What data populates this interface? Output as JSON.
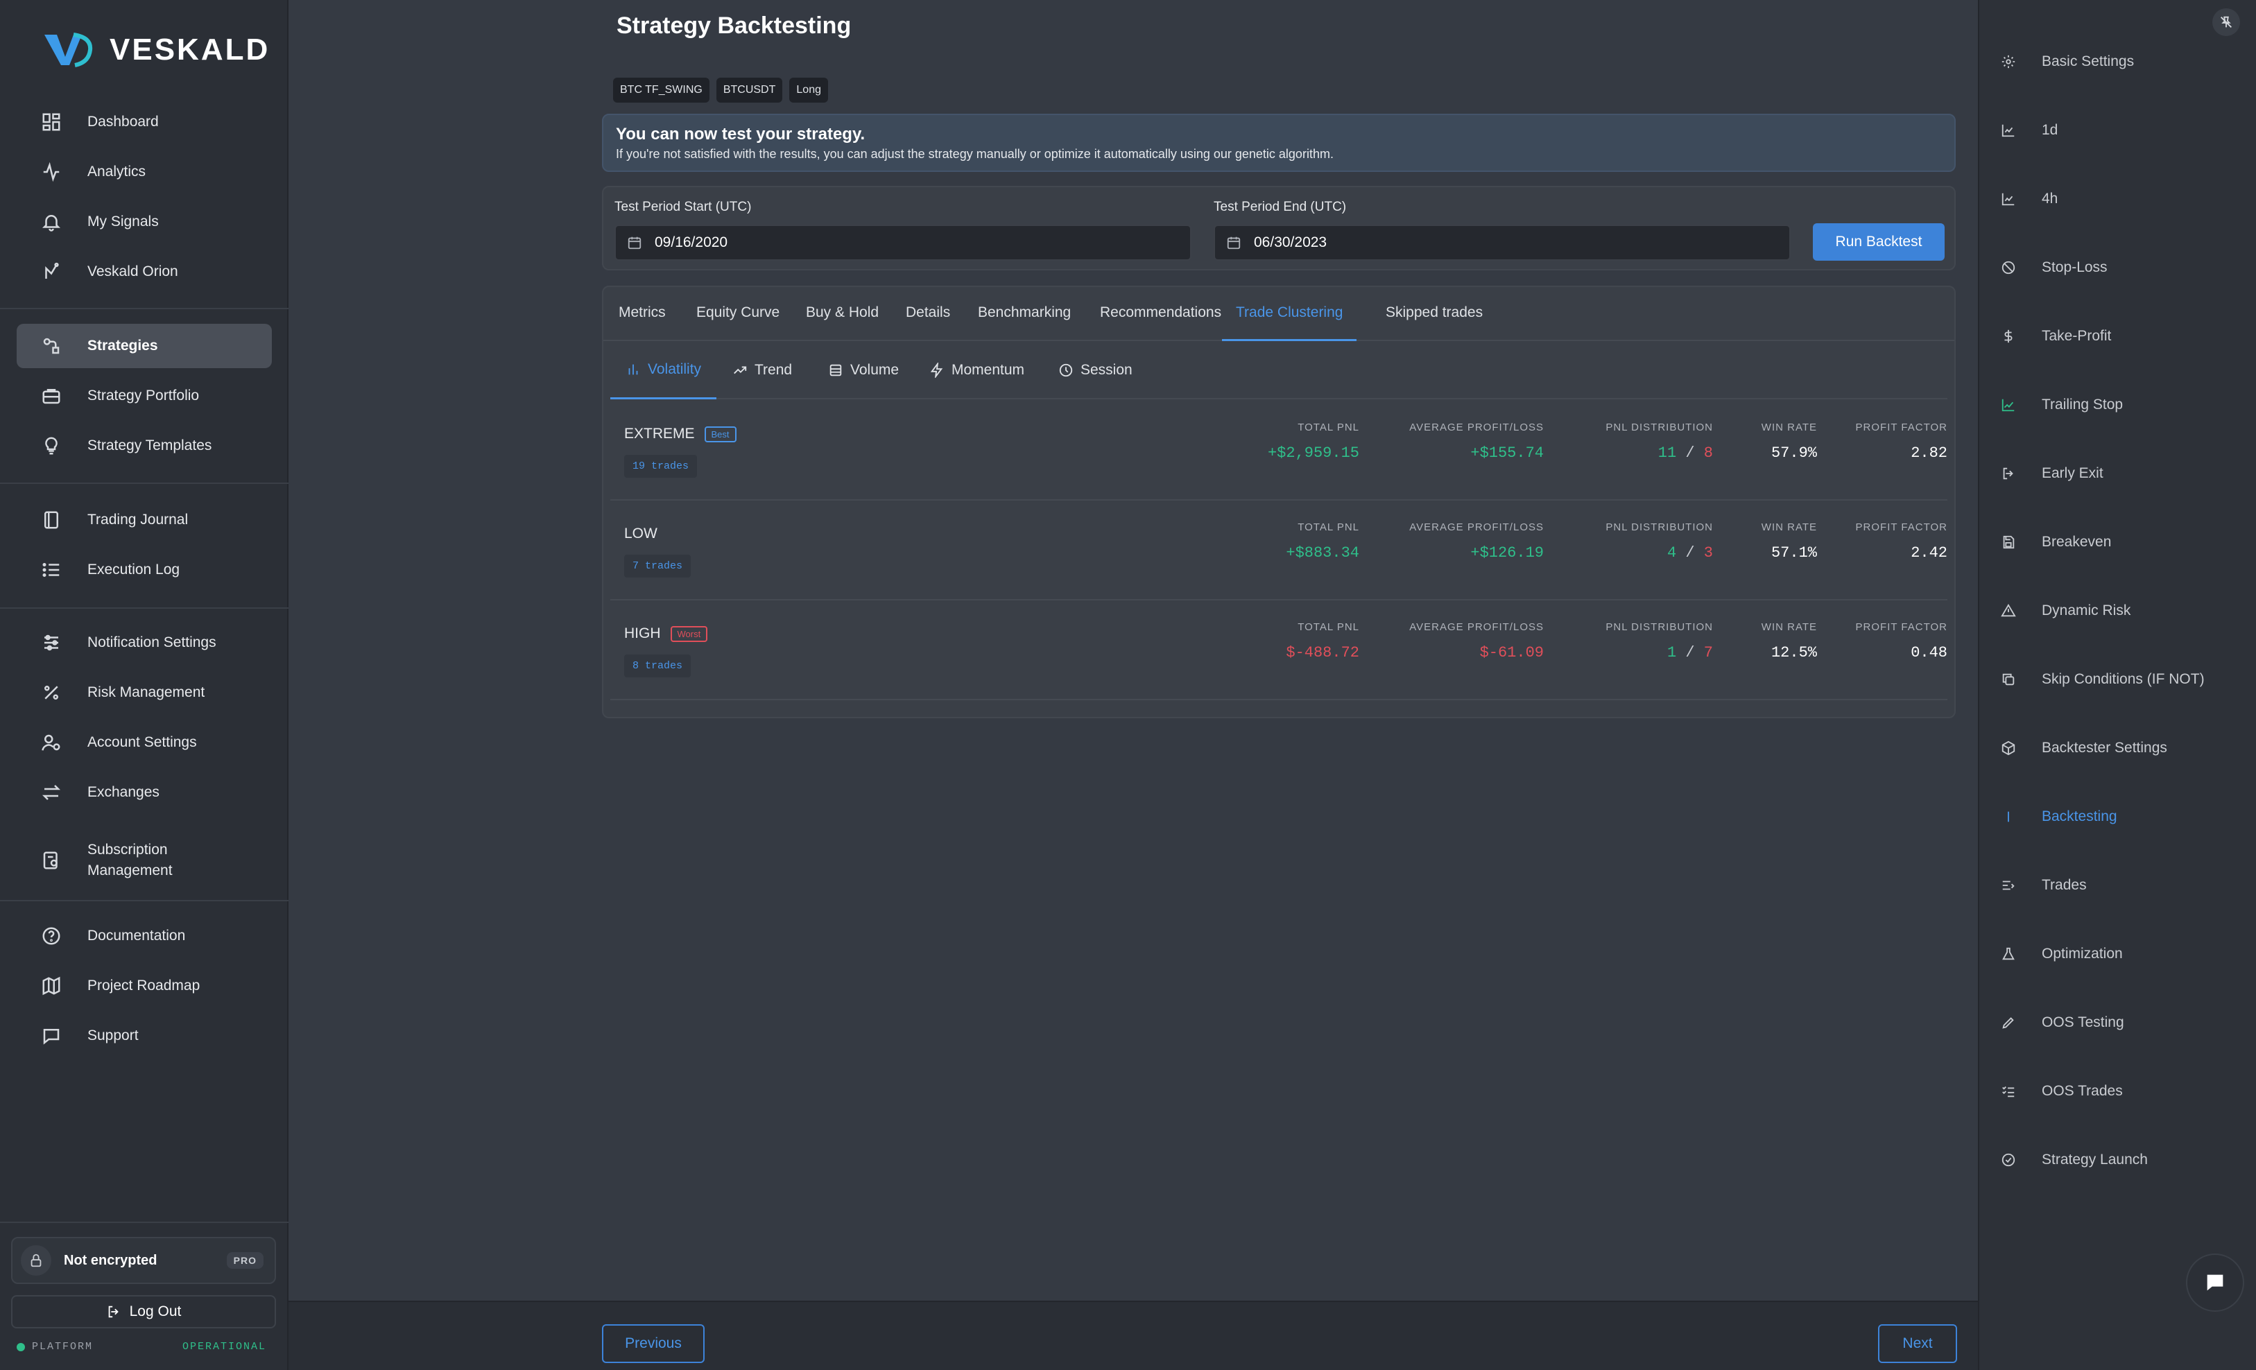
{
  "app": {
    "brand": "VESKALD"
  },
  "sidebar": {
    "groups": [
      [
        {
          "label": "Dashboard",
          "icon": "dashboard-icon"
        },
        {
          "label": "Analytics",
          "icon": "analytics-icon"
        },
        {
          "label": "My Signals",
          "icon": "bell-icon"
        },
        {
          "label": "Veskald Orion",
          "icon": "orion-icon"
        }
      ],
      [
        {
          "label": "Strategies",
          "icon": "strategies-icon",
          "active": true
        },
        {
          "label": "Strategy Portfolio",
          "icon": "briefcase-icon"
        },
        {
          "label": "Strategy Templates",
          "icon": "lightbulb-icon"
        }
      ],
      [
        {
          "label": "Trading Journal",
          "icon": "journal-icon"
        },
        {
          "label": "Execution Log",
          "icon": "list-icon"
        }
      ],
      [
        {
          "label": "Notification Settings",
          "icon": "sliders-icon"
        },
        {
          "label": "Risk Management",
          "icon": "percent-icon"
        },
        {
          "label": "Account Settings",
          "icon": "user-gear-icon"
        },
        {
          "label": "Exchanges",
          "icon": "exchange-icon"
        },
        {
          "label": "Subscription Management",
          "icon": "subscription-icon"
        }
      ],
      [
        {
          "label": "Documentation",
          "icon": "help-icon"
        },
        {
          "label": "Project Roadmap",
          "icon": "map-icon"
        },
        {
          "label": "Support",
          "icon": "chat-icon"
        }
      ]
    ],
    "encryption": {
      "label": "Not encrypted",
      "badge": "PRO"
    },
    "logout_label": "Log Out",
    "status": {
      "left": "PLATFORM",
      "right": "OPERATIONAL"
    }
  },
  "main": {
    "title": "Strategy Backtesting",
    "chips": [
      "BTC TF_SWING",
      "BTCUSDT",
      "Long"
    ],
    "info": {
      "title": "You can now test your strategy.",
      "subtitle": "If you're not satisfied with the results, you can adjust the strategy manually or optimize it automatically using our genetic algorithm."
    },
    "period": {
      "start_label": "Test Period Start (UTC)",
      "start_value": "09/16/2020",
      "end_label": "Test Period End (UTC)",
      "end_value": "06/30/2023",
      "run_label": "Run Backtest"
    },
    "tabs": [
      "Metrics",
      "Equity Curve",
      "Buy & Hold",
      "Details",
      "Benchmarking",
      "Recommendations",
      "Trade Clustering",
      "Skipped trades"
    ],
    "active_tab": "Trade Clustering",
    "subtabs": [
      "Volatility",
      "Trend",
      "Volume",
      "Momentum",
      "Session"
    ],
    "active_subtab": "Volatility",
    "metric_labels": [
      "TOTAL PNL",
      "AVERAGE PROFIT/LOSS",
      "PNL DISTRIBUTION",
      "WIN RATE",
      "PROFIT FACTOR"
    ],
    "clusters": [
      {
        "name": "EXTREME",
        "tag": "Best",
        "trades": "19 trades",
        "total_pnl": "+$2,959.15",
        "avg": "+$155.74",
        "wins": "11",
        "losses": "8",
        "win_rate": "57.9%",
        "profit_factor": "2.82"
      },
      {
        "name": "LOW",
        "tag": "",
        "trades": "7 trades",
        "total_pnl": "+$883.34",
        "avg": "+$126.19",
        "wins": "4",
        "losses": "3",
        "win_rate": "57.1%",
        "profit_factor": "2.42"
      },
      {
        "name": "HIGH",
        "tag": "Worst",
        "trades": "8 trades",
        "total_pnl": "$-488.72",
        "avg": "$-61.09",
        "wins": "1",
        "losses": "7",
        "win_rate": "12.5%",
        "profit_factor": "0.48"
      }
    ]
  },
  "pagination": {
    "previous": "Previous",
    "next": "Next"
  },
  "steps": [
    {
      "label": "Basic Settings",
      "icon": "gear-icon"
    },
    {
      "label": "1d",
      "icon": "chart-icon"
    },
    {
      "label": "4h",
      "icon": "chart-icon"
    },
    {
      "label": "Stop-Loss",
      "icon": "ban-icon"
    },
    {
      "label": "Take-Profit",
      "icon": "dollar-icon"
    },
    {
      "label": "Trailing Stop",
      "icon": "trend-icon",
      "state": "green"
    },
    {
      "label": "Early Exit",
      "icon": "exit-icon"
    },
    {
      "label": "Breakeven",
      "icon": "save-icon"
    },
    {
      "label": "Dynamic Risk",
      "icon": "warning-icon"
    },
    {
      "label": "Skip Conditions (IF NOT)",
      "icon": "copy-icon"
    },
    {
      "label": "Backtester Settings",
      "icon": "cube-icon"
    },
    {
      "label": "Backtesting",
      "icon": "bar-icon",
      "state": "active"
    },
    {
      "label": "Trades",
      "icon": "trades-icon"
    },
    {
      "label": "Optimization",
      "icon": "flask-icon"
    },
    {
      "label": "OOS Testing",
      "icon": "pen-icon"
    },
    {
      "label": "OOS Trades",
      "icon": "checklist-icon"
    },
    {
      "label": "Strategy Launch",
      "icon": "check-circle-icon"
    }
  ]
}
